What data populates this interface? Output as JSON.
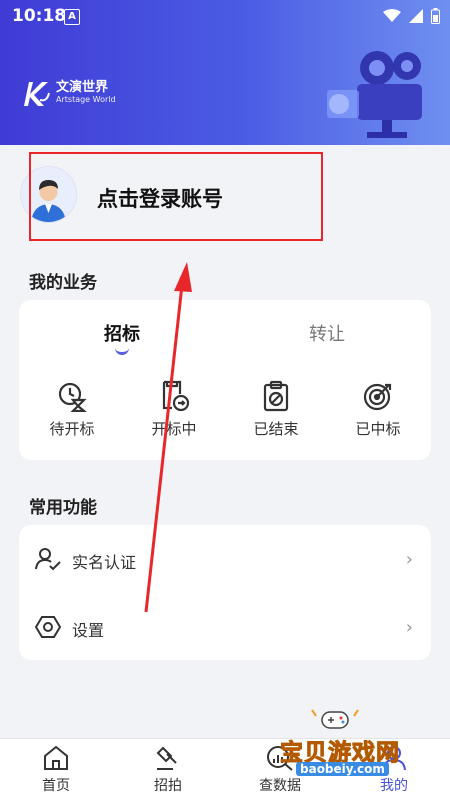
{
  "status_bar": {
    "time": "10:18",
    "notif": "A"
  },
  "brand": {
    "name_cn": "文演世界",
    "name_en": "Artstage World"
  },
  "profile": {
    "login_text": "点击登录账号"
  },
  "my_business": {
    "title": "我的业务",
    "tabs": [
      {
        "label": "招标",
        "active": true
      },
      {
        "label": "转让",
        "active": false
      }
    ],
    "items": [
      {
        "label": "待开标",
        "icon": "hourglass-icon"
      },
      {
        "label": "开标中",
        "icon": "doc-arrow-icon"
      },
      {
        "label": "已结束",
        "icon": "clipboard-slash-icon"
      },
      {
        "label": "已中标",
        "icon": "target-icon"
      }
    ]
  },
  "common_functions": {
    "title": "常用功能",
    "items": [
      {
        "label": "实名认证",
        "icon": "user-check-icon"
      },
      {
        "label": "设置",
        "icon": "settings-icon"
      }
    ]
  },
  "tabbar": {
    "items": [
      {
        "label": "首页",
        "icon": "home-icon"
      },
      {
        "label": "招拍",
        "icon": "gavel-icon"
      },
      {
        "label": "查数据",
        "icon": "data-icon"
      },
      {
        "label": "我的",
        "icon": "user-icon",
        "active": true
      }
    ]
  },
  "watermark": {
    "text": "宝贝游戏网",
    "url": "baobeiy.com"
  },
  "colors": {
    "header": "#4b5de4",
    "accent": "#5a5fe0",
    "annotation": "#e8272b"
  }
}
